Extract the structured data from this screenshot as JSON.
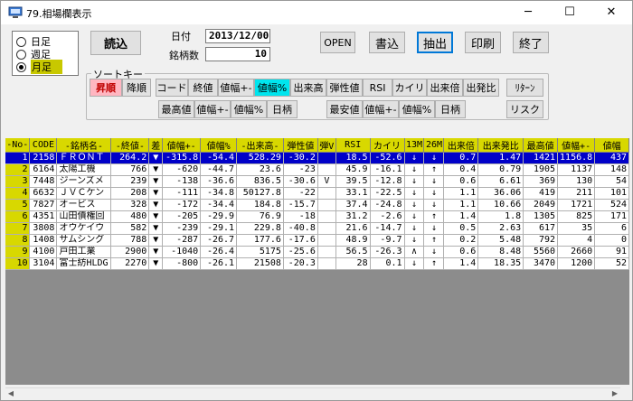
{
  "window": {
    "title": "79.相場欄表示",
    "minimize": "─",
    "maximize": "☐",
    "close": "✕"
  },
  "period": {
    "options": [
      "日足",
      "週足",
      "月足"
    ],
    "selected": "月足"
  },
  "buttons": {
    "load": "読込",
    "open": "OPEN",
    "write": "書込",
    "extract": "抽出",
    "print": "印刷",
    "exit": "終了"
  },
  "info": {
    "date_label": "日付",
    "date_value": "2013/12/00",
    "count_label": "銘柄数",
    "count_value": "10"
  },
  "sort": {
    "group_label": "ソートキー",
    "order": [
      "昇順",
      "降順"
    ],
    "row1": [
      "コード",
      "終値",
      "値幅+-",
      "値幅%",
      "出来高",
      "弾性値",
      "RSI",
      "カイリ",
      "出来倍",
      "出発比"
    ],
    "row2": [
      "最高値",
      "値幅+-",
      "値幅%",
      "日柄",
      "最安値",
      "値幅+-",
      "値幅%",
      "日柄"
    ],
    "return_btn": "ﾘﾀｰﾝ",
    "risk_btn": "リスク",
    "active_order": "昇順",
    "active_key": "値幅%"
  },
  "colors": {
    "header_yellow": "#d8d800",
    "selected_row": "#0000c8",
    "pink_button": "#ffb6c1",
    "cyan_button": "#00e5ee"
  },
  "table": {
    "headers": [
      "-No-",
      "CODE",
      "-銘柄名-",
      "-終値-",
      "差",
      "値幅+-",
      "値幅%",
      "-出来高-",
      "弾性値",
      "弾V",
      "RSI",
      "カイリ",
      "13M",
      "26M",
      "出来倍",
      "出来発比",
      "最高値",
      "値幅+-",
      "値幅"
    ],
    "rows": [
      [
        "1",
        "2158",
        "ＦＲＯＮＴ",
        "264.2",
        "▼",
        "-315.8",
        "-54.4",
        "528.29",
        "-30.2",
        "",
        "18.5",
        "-52.6",
        "↓",
        "↓",
        "0.7",
        "1.47",
        "1421",
        "1156.8",
        "437"
      ],
      [
        "2",
        "6164",
        "太陽工機",
        "766",
        "▼",
        "-620",
        "-44.7",
        "23.6",
        "-23",
        "",
        "45.9",
        "-16.1",
        "↓",
        "↑",
        "0.4",
        "0.79",
        "1905",
        "1137",
        "148"
      ],
      [
        "3",
        "7448",
        "ジーンズメ",
        "239",
        "▼",
        "-138",
        "-36.6",
        "836.5",
        "-30.6",
        "V",
        "39.5",
        "-12.8",
        "↓",
        "↓",
        "0.6",
        "6.61",
        "369",
        "130",
        "54"
      ],
      [
        "4",
        "6632",
        "ＪＶＣケン",
        "208",
        "▼",
        "-111",
        "-34.8",
        "50127.8",
        "-22",
        "",
        "33.1",
        "-22.5",
        "↓",
        "↓",
        "1.1",
        "36.06",
        "419",
        "211",
        "101"
      ],
      [
        "5",
        "7827",
        "オービス",
        "328",
        "▼",
        "-172",
        "-34.4",
        "184.8",
        "-15.7",
        "",
        "37.4",
        "-24.8",
        "↓",
        "↓",
        "1.1",
        "10.66",
        "2049",
        "1721",
        "524"
      ],
      [
        "6",
        "4351",
        "山田債権回",
        "480",
        "▼",
        "-205",
        "-29.9",
        "76.9",
        "-18",
        "",
        "31.2",
        "-2.6",
        "↓",
        "↑",
        "1.4",
        "1.8",
        "1305",
        "825",
        "171"
      ],
      [
        "7",
        "3808",
        "オウケイウ",
        "582",
        "▼",
        "-239",
        "-29.1",
        "229.8",
        "-40.8",
        "",
        "21.6",
        "-14.7",
        "↓",
        "↓",
        "0.5",
        "2.63",
        "617",
        "35",
        "6"
      ],
      [
        "8",
        "1408",
        "サムシング",
        "788",
        "▼",
        "-287",
        "-26.7",
        "177.6",
        "-17.6",
        "",
        "48.9",
        "-9.7",
        "↓",
        "↑",
        "0.2",
        "5.48",
        "792",
        "4",
        "0"
      ],
      [
        "9",
        "4100",
        "戸田工業",
        "2900",
        "▼",
        "-1040",
        "-26.4",
        "5175",
        "-25.6",
        "",
        "56.5",
        "-26.3",
        "∧",
        "↓",
        "0.6",
        "8.48",
        "5560",
        "2660",
        "91"
      ],
      [
        "10",
        "3104",
        "富士紡HLDG",
        "2270",
        "▼",
        "-800",
        "-26.1",
        "21508",
        "-20.3",
        "",
        "28",
        "0.1",
        "↓",
        "↑",
        "1.4",
        "18.35",
        "3470",
        "1200",
        "52"
      ]
    ]
  }
}
